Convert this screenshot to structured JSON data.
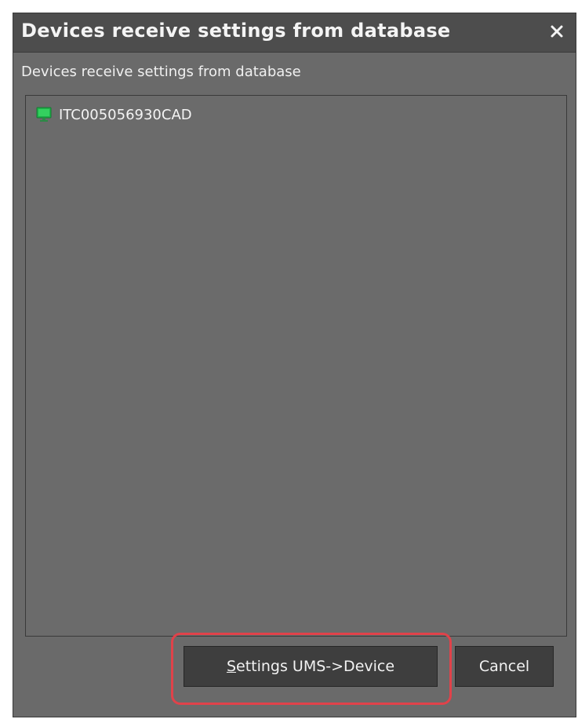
{
  "dialog": {
    "title": "Devices receive settings from database",
    "subtitle": "Devices receive settings from database",
    "close_icon": "close-icon"
  },
  "device_list": {
    "items": [
      {
        "label": "ITC005056930CAD",
        "icon": "monitor-icon",
        "icon_color": "#1fb34a"
      }
    ]
  },
  "buttons": {
    "primary": {
      "mnemonic": "S",
      "label_rest": "ettings UMS->Device",
      "highlighted": true,
      "highlight_color": "#e0424a"
    },
    "cancel": {
      "label": "Cancel"
    }
  },
  "colors": {
    "dialog_bg": "#6a6a6a",
    "titlebar_bg": "#4d4d4d",
    "button_bg": "#3e3e3e",
    "text": "#f4f4f4"
  }
}
